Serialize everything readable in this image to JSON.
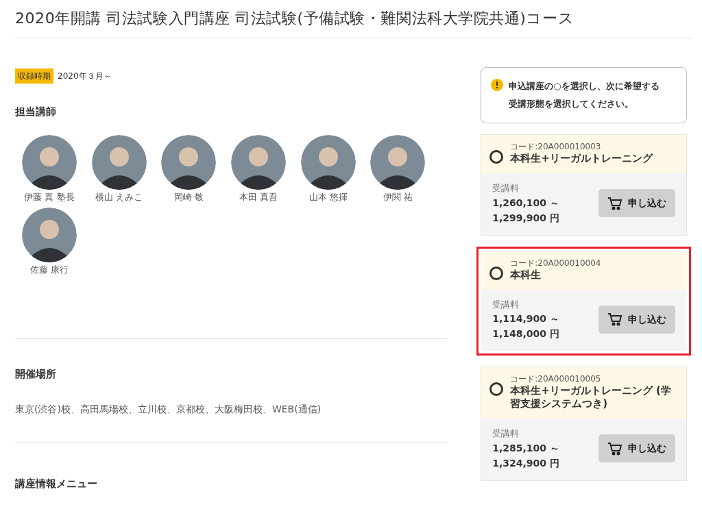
{
  "title": "2020年開講 司法試験入門講座 司法試験(予備試験・難関法科大学院共通)コース",
  "recording": {
    "label": "収録時期",
    "value": "2020年３月～"
  },
  "instructors": {
    "heading": "担当講師",
    "people": [
      {
        "name": "伊藤 真 塾長"
      },
      {
        "name": "横山 えみこ"
      },
      {
        "name": "岡崎 敬"
      },
      {
        "name": "本田 真吾"
      },
      {
        "name": "山本 悠揮"
      },
      {
        "name": "伊関 祐"
      },
      {
        "name": "佐藤 康行"
      }
    ]
  },
  "venue": {
    "heading": "開催場所",
    "text": "東京(渋谷)校、高田馬場校、立川校、京都校、大阪梅田校、WEB(通信)"
  },
  "menu": {
    "heading": "講座情報メニュー"
  },
  "notice": "申込講座の○を選択し、次に希望する受講形態を選択してください。",
  "plans": [
    {
      "code": "コード:20A000010003",
      "name": "本科生+リーガルトレーニング",
      "fee_label": "受講料",
      "price_from": "1,260,100 ～",
      "price_to": "1,299,900 円",
      "button": "申し込む",
      "selected": false,
      "highlighted": false
    },
    {
      "code": "コード:20A000010004",
      "name": "本科生",
      "fee_label": "受講料",
      "price_from": "1,114,900 ～",
      "price_to": "1,148,000 円",
      "button": "申し込む",
      "selected": false,
      "highlighted": true
    },
    {
      "code": "コード:20A000010005",
      "name": "本科生+リーガルトレーニング (学習支援システムつき)",
      "fee_label": "受講料",
      "price_from": "1,285,100 ～",
      "price_to": "1,324,900 円",
      "button": "申し込む",
      "selected": false,
      "highlighted": false
    }
  ]
}
